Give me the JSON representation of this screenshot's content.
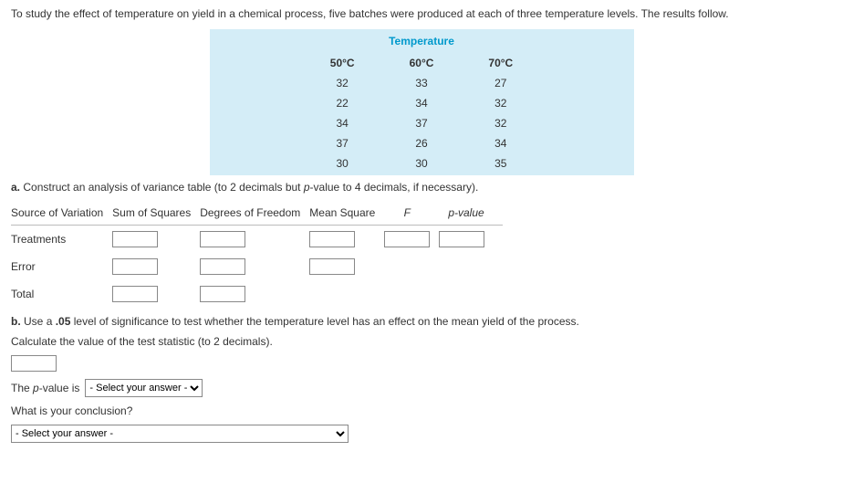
{
  "intro": "To study the effect of temperature on yield in a chemical process, five batches were produced at each of three temperature levels. The results follow.",
  "dataTable": {
    "title": "Temperature",
    "headers": [
      "50°C",
      "60°C",
      "70°C"
    ],
    "rows": [
      [
        "32",
        "33",
        "27"
      ],
      [
        "22",
        "34",
        "32"
      ],
      [
        "34",
        "37",
        "32"
      ],
      [
        "37",
        "26",
        "34"
      ],
      [
        "30",
        "30",
        "35"
      ]
    ]
  },
  "partA": {
    "label": "a.",
    "text": "Construct an analysis of variance table (to 2 decimals but ",
    "italic": "p",
    "text2": "-value to 4 decimals, if necessary)."
  },
  "anova": {
    "headers": {
      "sov": "Source of Variation",
      "ss": "Sum of Squares",
      "df": "Degrees of Freedom",
      "ms": "Mean Square",
      "f": "F",
      "p": "p",
      "pValueSuffix": "-value"
    },
    "rows": {
      "treatments": "Treatments",
      "error": "Error",
      "total": "Total"
    }
  },
  "partB": {
    "label": "b.",
    "text": "Use a ",
    "alpha": ".05",
    "text2": " level of significance to test whether the temperature level has an effect on the mean yield of the process."
  },
  "calcText": "Calculate the value of the test statistic (to 2 decimals).",
  "pLine": {
    "prefix": "The ",
    "p": "p",
    "suffix": "-value is"
  },
  "conclusionQ": "What is your conclusion?",
  "selectPlaceholder": "- Select your answer -"
}
